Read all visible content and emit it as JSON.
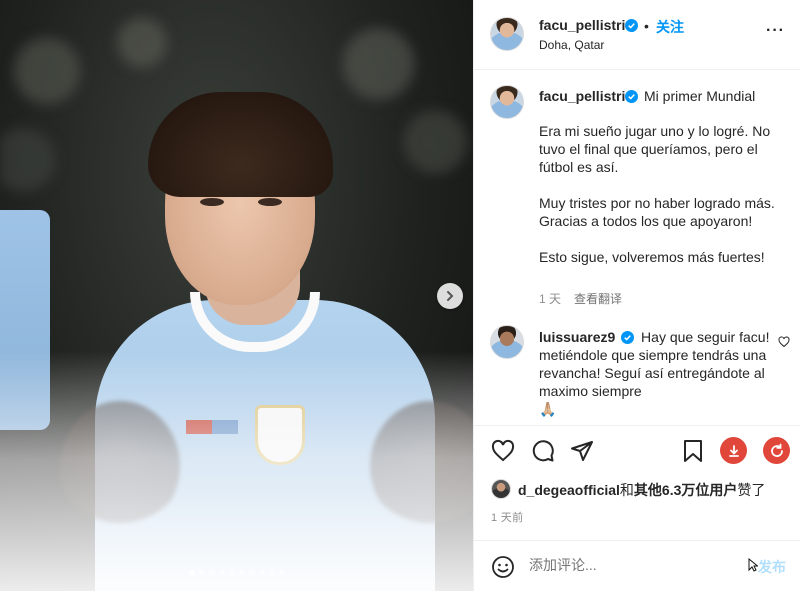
{
  "post": {
    "username": "facu_pellistri",
    "follow_label": "关注",
    "separator": "•",
    "location": "Doha, Qatar",
    "more_label": "···"
  },
  "caption": {
    "username": "facu_pellistri",
    "title": "Mi primer Mundial",
    "paragraphs": [
      "Era mi sueño jugar uno y lo logré. No tuvo el final que queríamos, pero el fútbol es así.",
      "Muy tristes por no haber logrado más. Gracias a todos los que apoyaron!",
      "Esto sigue, volveremos más fuertes!"
    ],
    "time": "1 天",
    "translate_label": "查看翻译"
  },
  "comment": {
    "username": "luissuarez9",
    "text": "Hay que seguir facu! metiéndole que siempre tendrás una revancha! Seguí así entregándote al maximo siempre",
    "emoji": "🙏🏼"
  },
  "likes": {
    "user": "d_degeaofficial",
    "connector": "和",
    "others": "其他6.3万位用户",
    "suffix": "赞了"
  },
  "time_ago": "1 天前",
  "comment_input": {
    "placeholder": "添加评论...",
    "post_label": "发布"
  },
  "carousel": {
    "slide_count": 10,
    "active_index": 0
  },
  "colors": {
    "accent": "#0095f6",
    "verified": "#0095f6",
    "text": "#262626",
    "muted": "#8e8e8e",
    "extension_red": "#e0463a"
  },
  "icons": [
    "next-arrow-icon",
    "verified-icon",
    "heart-icon",
    "comment-icon",
    "share-icon",
    "bookmark-icon",
    "download-icon",
    "refresh-icon",
    "emoji-icon",
    "cursor-icon"
  ]
}
